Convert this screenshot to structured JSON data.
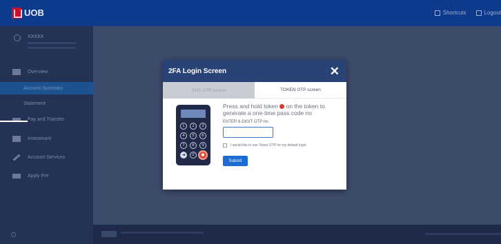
{
  "header": {
    "brand": "UOB",
    "brand_sub": "",
    "shortcuts_label": "Shortcuts",
    "logout_label": "Logout"
  },
  "sidebar": {
    "user_name": "XXXXX",
    "items": [
      {
        "label": "Overview",
        "icon": "grid-icon"
      },
      {
        "label": "Account Summary",
        "icon": ""
      },
      {
        "label": "Statement",
        "icon": ""
      },
      {
        "label": "Pay and Transfer",
        "icon": "transfer-icon"
      },
      {
        "label": "Investment",
        "icon": "chart-icon"
      },
      {
        "label": "Account Services",
        "icon": "pencil-icon"
      },
      {
        "label": "Apply Pre",
        "icon": "card-icon"
      }
    ]
  },
  "modal": {
    "title": "2FA Login Screen",
    "close_label": "✕",
    "tabs": [
      {
        "label": "SMS OTP screen",
        "active": false
      },
      {
        "label": "TOKEN OTP screen",
        "active": true
      }
    ],
    "instruction_part1": "Press and hold token",
    "instruction_part2": "on the token to generate a one-time pass code no",
    "otp_label": "ENTER 6-DIGIT OTP no",
    "otp_value": "",
    "default_label": "I would like to use Token OTP for my default login",
    "submit_label": "Submit",
    "token_keys": [
      "1",
      "2",
      "3",
      "4",
      "5",
      "6",
      "7",
      "8",
      "9",
      "◄",
      "0",
      "●"
    ]
  },
  "colors": {
    "header_bg": "#0e3a8c",
    "modal_header": "#2a4377",
    "submit": "#1b6dd3",
    "token_button": "#d83a2a"
  }
}
